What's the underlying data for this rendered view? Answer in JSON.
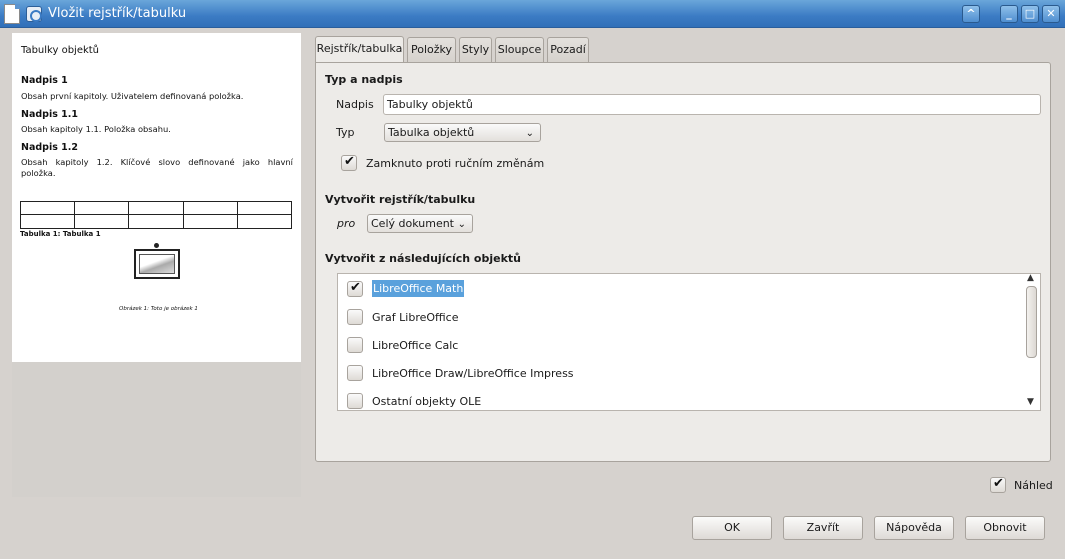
{
  "window": {
    "title": "Vložit rejstřík/tabulku",
    "controls": {
      "up": "^",
      "minimize": "_",
      "maximize": "□",
      "close": "✕"
    }
  },
  "preview": {
    "title": "Tabulky objektů",
    "sections": [
      {
        "heading": "Nadpis 1",
        "text": "Obsah první kapitoly. Uživatelem definovaná položka."
      },
      {
        "heading": "Nadpis 1.1",
        "text": "Obsah kapitoly 1.1. Položka obsahu."
      },
      {
        "heading": "Nadpis 1.2",
        "text_line1": "Obsah kapitoly 1.2. Klíčové slovo definované jako hlavní",
        "text_line2": "položka."
      }
    ],
    "table_caption": "Tabulka 1: Tabulka 1",
    "image_caption": "Obrázek 1: Toto je obrázek 1"
  },
  "tabs": [
    {
      "label": "Rejstřík/tabulka",
      "active": true
    },
    {
      "label": "Položky"
    },
    {
      "label": "Styly"
    },
    {
      "label": "Sloupce"
    },
    {
      "label": "Pozadí"
    }
  ],
  "type_section": {
    "heading": "Typ a nadpis",
    "title_label": "Nadpis",
    "title_value": "Tabulky objektů",
    "type_label": "Typ",
    "type_value": "Tabulka objektů",
    "protect_label": "Zamknuto proti ručním změnám",
    "protect_checked": true
  },
  "create_section": {
    "heading": "Vytvořit rejstřík/tabulku",
    "for_label": "pro",
    "for_value": "Celý dokument"
  },
  "objects_section": {
    "heading": "Vytvořit z následujících objektů",
    "items": [
      {
        "label": "LibreOffice Math",
        "checked": true,
        "selected": true
      },
      {
        "label": "Graf LibreOffice",
        "checked": false
      },
      {
        "label": "LibreOffice Calc",
        "checked": false
      },
      {
        "label": "LibreOffice Draw/LibreOffice Impress",
        "checked": false
      },
      {
        "label": "Ostatní objekty OLE",
        "checked": false
      }
    ]
  },
  "preview_toggle": {
    "label": "Náhled",
    "checked": true
  },
  "buttons": {
    "ok": "OK",
    "close": "Zavřít",
    "help": "Nápověda",
    "reset": "Obnovit"
  },
  "icons": {
    "check": "✔",
    "chevron": "⌄"
  }
}
